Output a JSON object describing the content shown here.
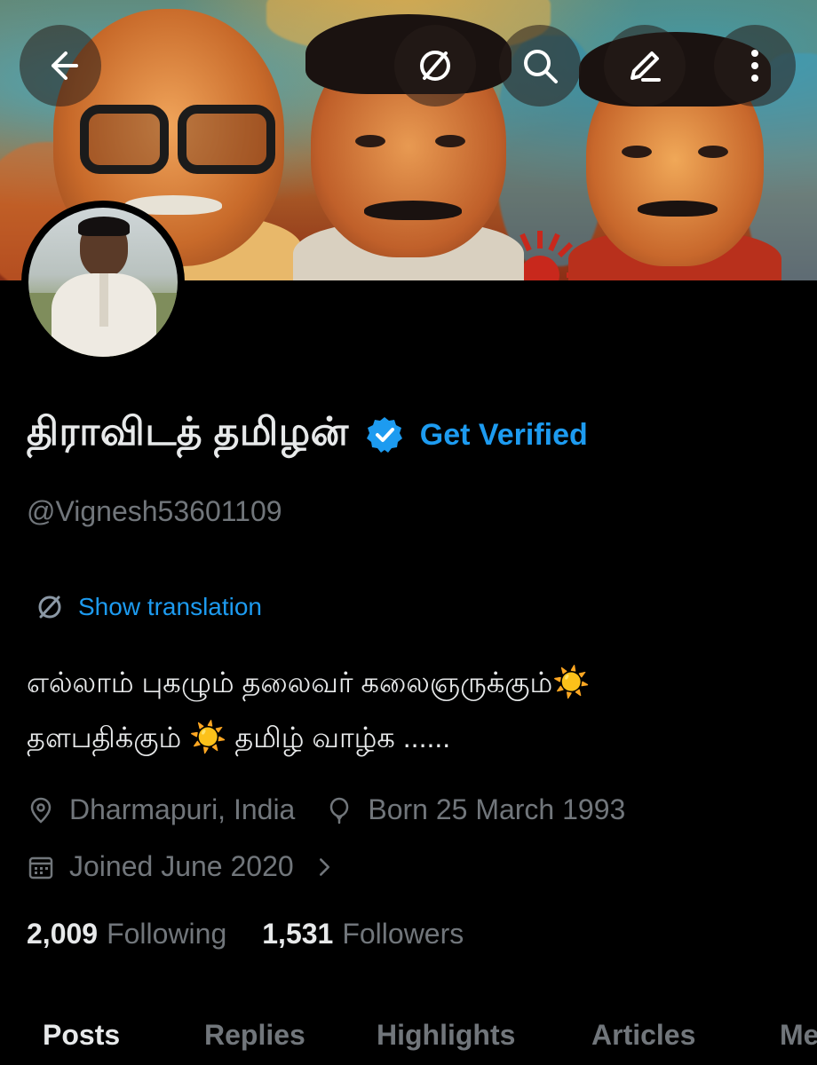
{
  "nav": {
    "back_icon": "arrow-left-icon",
    "translate_icon": "translate-icon",
    "search_icon": "search-icon",
    "edit_icon": "edit-icon",
    "more_icon": "more-vertical-icon"
  },
  "profile": {
    "display_name": "திராவிடத் தமிழன்",
    "verified_icon": "verified-badge-icon",
    "get_verified_label": "Get Verified",
    "handle": "@Vignesh53601109",
    "show_translation_label": "Show translation",
    "bio_line1": "எல்லாம் புகழும் தலைவர் கலைஞருக்கும்",
    "bio_line2a": "தளபதிக்கும்",
    "bio_line2b": "தமிழ் வாழ்க ......",
    "bio_emoji": "☀️",
    "location": "Dharmapuri, India",
    "birthday": "Born 25 March 1993",
    "joined": "Joined June 2020",
    "following_count": "2,009",
    "following_label": "Following",
    "followers_count": "1,531",
    "followers_label": "Followers"
  },
  "tabs": [
    "Posts",
    "Replies",
    "Highlights",
    "Articles",
    "Media"
  ],
  "active_tab": "Posts",
  "colors": {
    "accent": "#1d9bf0",
    "muted": "#71767b",
    "text": "#e7e9ea",
    "background": "#000000"
  }
}
